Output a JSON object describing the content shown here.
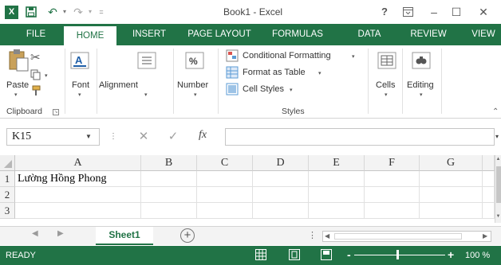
{
  "window": {
    "title": "Book1 - Excel",
    "app_icon_glyph": "X",
    "undo_glyph": "↶",
    "redo_glyph": "↷",
    "help_glyph": "?",
    "minimize_glyph": "–",
    "maximize_glyph": "☐",
    "close_glyph": "✕"
  },
  "ribbon_tabs": [
    "FILE",
    "HOME",
    "INSERT",
    "PAGE LAYOUT",
    "FORMULAS",
    "DATA",
    "REVIEW",
    "VIEW"
  ],
  "active_tab": "HOME",
  "ribbon": {
    "clipboard": {
      "paste": "Paste",
      "group_label": "Clipboard"
    },
    "font": {
      "label": "Font"
    },
    "alignment": {
      "label": "Alignment"
    },
    "number": {
      "label": "Number"
    },
    "styles": {
      "conditional_formatting": "Conditional Formatting",
      "format_as_table": "Format as Table",
      "cell_styles": "Cell Styles",
      "group_label": "Styles"
    },
    "cells": {
      "label": "Cells"
    },
    "editing": {
      "label": "Editing"
    }
  },
  "formula_bar": {
    "name_box": "K15",
    "cancel_glyph": "✕",
    "enter_glyph": "✓",
    "fx": "fx",
    "formula": ""
  },
  "grid": {
    "columns": [
      "A",
      "B",
      "C",
      "D",
      "E",
      "F",
      "G"
    ],
    "rows": [
      "1",
      "2",
      "3"
    ],
    "cells": {
      "A1": "Lường Hồng Phong"
    }
  },
  "sheets": [
    "Sheet1"
  ],
  "active_sheet": "Sheet1",
  "add_sheet_glyph": "+",
  "status": {
    "text": "READY",
    "zoom_minus": "-",
    "zoom_plus": "+",
    "zoom": "100 %"
  },
  "colors": {
    "accent": "#217346",
    "status_bar": "#217346"
  }
}
